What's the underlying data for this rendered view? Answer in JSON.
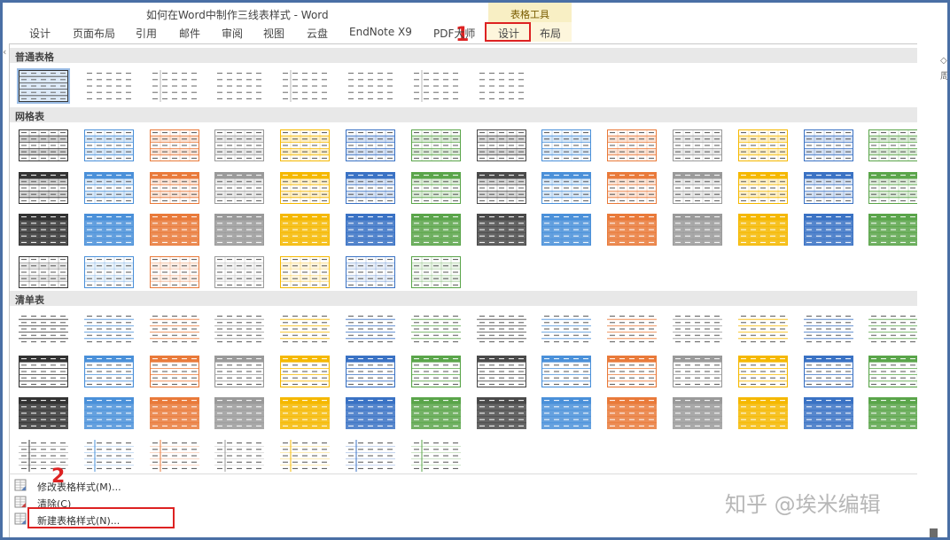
{
  "window": {
    "title": "如何在Word中制作三线表样式 - Word"
  },
  "context_tab": {
    "title": "表格工具"
  },
  "tabs": [
    {
      "label": "设计",
      "name": "tab-design"
    },
    {
      "label": "页面布局",
      "name": "tab-page-layout"
    },
    {
      "label": "引用",
      "name": "tab-references"
    },
    {
      "label": "邮件",
      "name": "tab-mailings"
    },
    {
      "label": "审阅",
      "name": "tab-review"
    },
    {
      "label": "视图",
      "name": "tab-view"
    },
    {
      "label": "云盘",
      "name": "tab-cloud"
    },
    {
      "label": "EndNote X9",
      "name": "tab-endnote"
    },
    {
      "label": "PDF大师",
      "name": "tab-pdf"
    },
    {
      "label": "设计",
      "name": "tab-table-design"
    },
    {
      "label": "布局",
      "name": "tab-table-layout"
    }
  ],
  "annotations": {
    "step1": "1",
    "step2": "2"
  },
  "gallery": {
    "sections": [
      {
        "name": "plain-tables",
        "title": "普通表格",
        "rows": [
          8
        ]
      },
      {
        "name": "grid-tables",
        "title": "网格表",
        "rows": [
          14,
          14,
          14,
          7
        ]
      },
      {
        "name": "list-tables",
        "title": "清单表",
        "rows": [
          14,
          14,
          14,
          7
        ]
      }
    ],
    "style_colors": [
      "#333333",
      "#4a90d9",
      "#e97a3a",
      "#9a9a9a",
      "#f5b800",
      "#3a72c4",
      "#5aa54a"
    ],
    "gray_color": "#4a4a4a"
  },
  "footer": {
    "items": [
      {
        "name": "modify-style-item",
        "label": "修改表格样式(M)...",
        "icon": "modify-style-icon"
      },
      {
        "name": "clear-item",
        "label": "清除(C)",
        "icon": "clear-icon"
      },
      {
        "name": "new-style-item",
        "label": "新建表格样式(N)...",
        "icon": "new-style-icon"
      }
    ]
  },
  "watermark": {
    "text": "知乎 @埃米编辑"
  },
  "right_pane": {
    "char1": "◇",
    "char2": "周"
  }
}
